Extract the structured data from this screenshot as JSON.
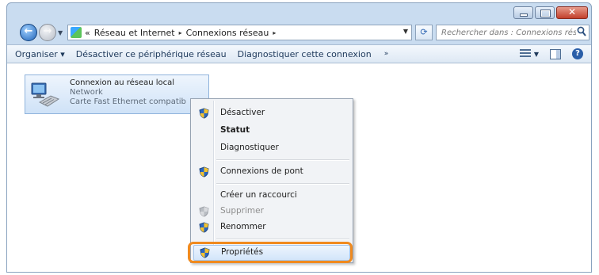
{
  "window": {
    "caption_buttons": [
      {
        "name": "minimize",
        "icon": "minimize-icon"
      },
      {
        "name": "maximize",
        "icon": "maximize-icon"
      },
      {
        "name": "close",
        "icon": "close-icon",
        "glyph": "✕"
      }
    ]
  },
  "nav": {
    "back_glyph": "←",
    "forward_glyph": "→",
    "address": {
      "prefix": "«",
      "crumbs": [
        "Réseau et Internet",
        "Connexions réseau"
      ],
      "separator": "▸"
    },
    "refresh_glyph": "⟳",
    "search_placeholder": "Rechercher dans : Connexions rése..."
  },
  "commandbar": {
    "items": [
      "Organiser ▾",
      "Désactiver ce périphérique réseau",
      "Diagnostiquer cette connexion"
    ],
    "more": "»"
  },
  "network_item": {
    "name": "Connexion au réseau local",
    "status": "Network",
    "adapter": "Carte Fast Ethernet compatib"
  },
  "context_menu": {
    "items": [
      {
        "label": "Désactiver",
        "shield": true
      },
      {
        "label": "Statut",
        "bold": true
      },
      {
        "label": "Diagnostiquer"
      },
      {
        "label": "Connexions de pont",
        "shield": true
      },
      {
        "label": "Créer un raccourci"
      },
      {
        "label": "Supprimer",
        "shield": true,
        "disabled": true
      },
      {
        "label": "Renommer",
        "shield": true
      },
      {
        "label": "Propriétés",
        "shield": true,
        "highlighted": true
      }
    ]
  },
  "colors": {
    "accent": "#1f63b8",
    "callout": "#f08a1e",
    "shield_blue": "#2a66c2",
    "shield_yellow": "#f2c230"
  }
}
